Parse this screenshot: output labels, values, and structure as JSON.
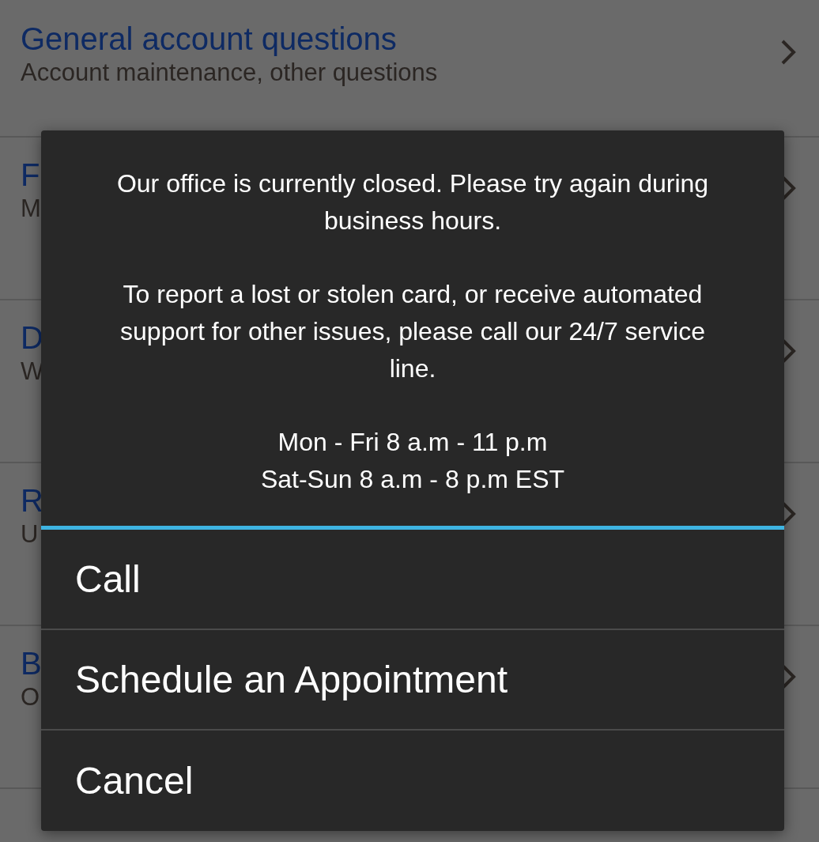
{
  "list": [
    {
      "title": "General account questions",
      "subtitle": "Account maintenance, other questions"
    },
    {
      "title": "F",
      "subtitle": "M"
    },
    {
      "title": "D",
      "subtitle": "W"
    },
    {
      "title": "R",
      "subtitle": "U"
    },
    {
      "title": "B",
      "subtitle": "O"
    }
  ],
  "dialog": {
    "message": [
      "Our office is currently closed. Please try again during business hours.",
      "To report a lost or stolen card, or receive automated support for other issues, please call our 24/7 service line."
    ],
    "hours": [
      "Mon - Fri 8 a.m - 11 p.m",
      "Sat-Sun 8 a.m - 8 p.m EST"
    ],
    "buttons": [
      "Call",
      "Schedule an Appointment",
      "Cancel"
    ]
  }
}
